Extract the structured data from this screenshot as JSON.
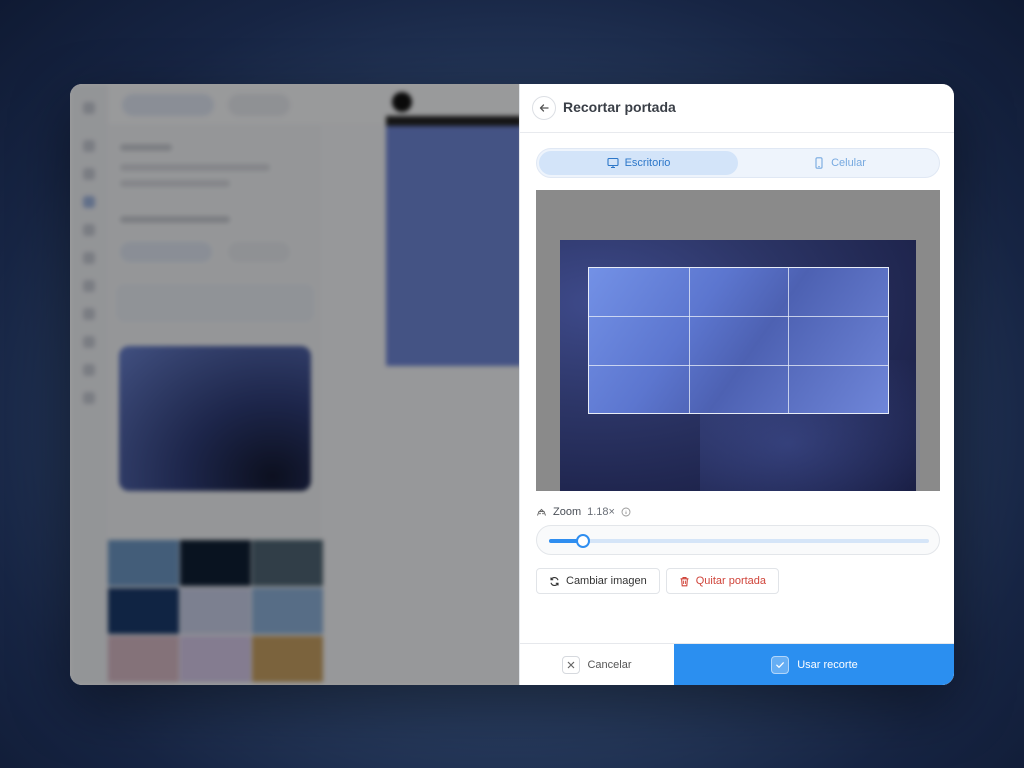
{
  "dialog": {
    "title": "Recortar portada"
  },
  "device_toggle": {
    "options": [
      {
        "label": "Escritorio",
        "icon": "monitor-icon",
        "active": true
      },
      {
        "label": "Celular",
        "icon": "smartphone-icon",
        "active": false
      }
    ]
  },
  "zoom": {
    "label": "Zoom",
    "value_text": "1.18×",
    "slider_fraction": 0.09
  },
  "actions": {
    "change_image_label": "Cambiar imagen",
    "remove_cover_label": "Quitar portada"
  },
  "footer": {
    "cancel_label": "Cancelar",
    "confirm_label": "Usar recorte"
  },
  "colors": {
    "accent": "#2b8ff0",
    "danger": "#d0453b",
    "segment_active_text": "#2d77c9"
  }
}
